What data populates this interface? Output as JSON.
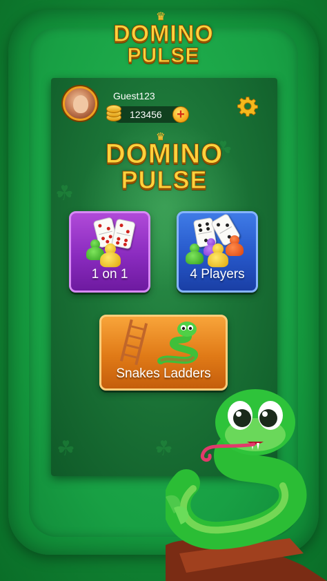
{
  "app": {
    "title_line1": "DOMINO",
    "title_line2": "PULSE"
  },
  "profile": {
    "username": "Guest123",
    "coins": "123456",
    "plus_label": "+"
  },
  "modes": {
    "one_on_one": {
      "label": "1 on 1"
    },
    "four_players": {
      "label": "4 Players"
    },
    "snakes": {
      "label": "Snakes Ladders"
    }
  },
  "icons": {
    "avatar": "avatar-icon",
    "coin": "coin-icon",
    "settings": "gear-icon"
  },
  "colors": {
    "background": "#138a36",
    "gold": "#ffd23c",
    "purple_card": "#8a2bbf",
    "blue_card": "#2657c9",
    "orange_card": "#e07a17"
  }
}
